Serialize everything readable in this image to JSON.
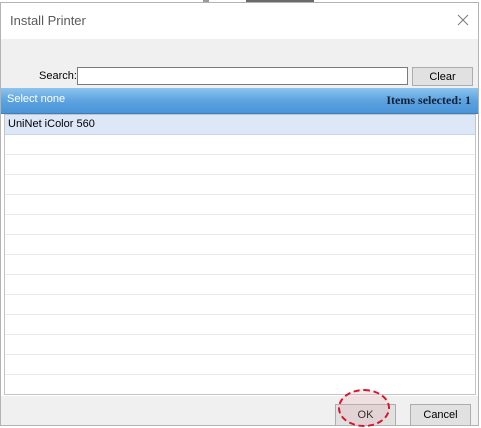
{
  "dialog": {
    "title": "Install Printer"
  },
  "search": {
    "label": "Search:",
    "value": "",
    "placeholder": "",
    "clear_label": "Clear"
  },
  "list_header": {
    "select_none_label": "Select none",
    "items_selected_label": "Items selected: 1"
  },
  "printers": [
    {
      "name": "UniNet iColor 560",
      "selected": true
    }
  ],
  "buttons": {
    "ok_label": "OK",
    "cancel_label": "Cancel"
  },
  "icons": {
    "close": "close-icon"
  },
  "colors": {
    "header_gradient_top": "#8ec4ee",
    "header_gradient_bottom": "#4b94d6",
    "selected_row": "#dce8f7",
    "highlight_ring": "#d4152b"
  }
}
